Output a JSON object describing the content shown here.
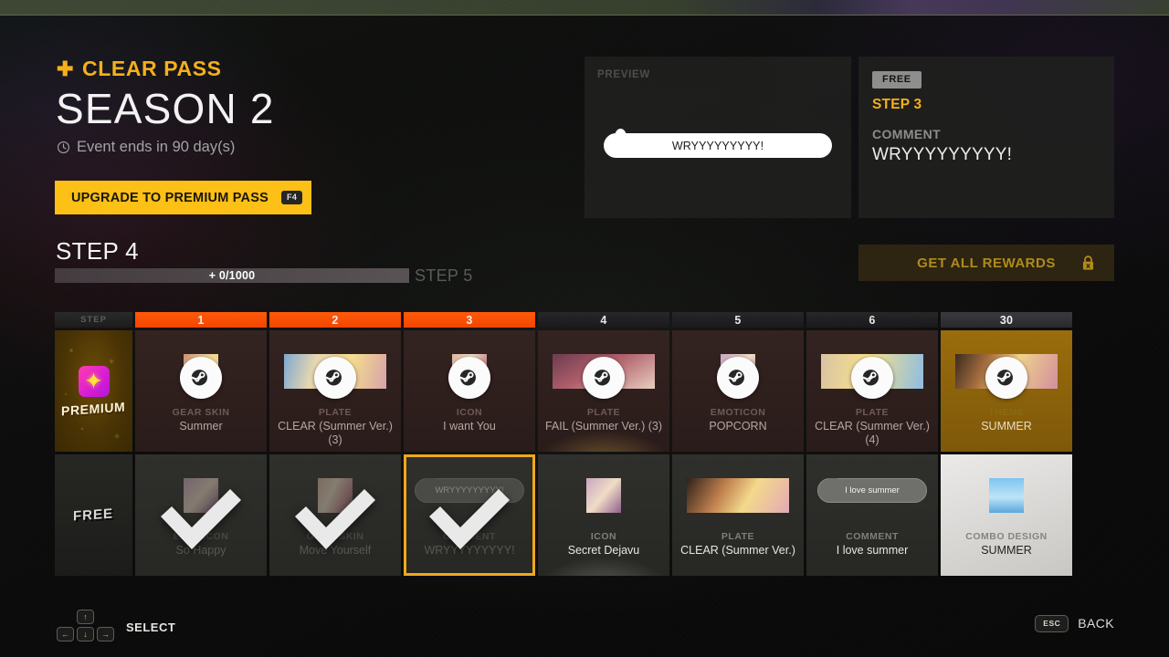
{
  "header": {
    "clear_pass_label": "CLEAR PASS",
    "clear_pass_star_icon": "plus-star-icon",
    "season_title": "SEASON 2",
    "event_text": "Event ends in 90 day(s)",
    "clock_icon": "clock-icon",
    "upgrade_button_label": "UPGRADE TO PREMIUM PASS",
    "upgrade_button_key": "F4"
  },
  "preview": {
    "label": "PREVIEW",
    "bubble_text": "WRYYYYYYYYY!"
  },
  "info": {
    "badge": "FREE",
    "step": "STEP 3",
    "category": "COMMENT",
    "name": "WRYYYYYYYYY!"
  },
  "progress": {
    "current_step_label": "STEP 4",
    "bar_text": "+ 0/1000",
    "percent": 0,
    "next_step_label": "STEP 5"
  },
  "rewards_button": {
    "label": "GET ALL REWARDS",
    "lock_icon": "lock-icon",
    "locked": true
  },
  "grid": {
    "step_header_label": "STEP",
    "steps": [
      {
        "label": "1",
        "state": "done"
      },
      {
        "label": "2",
        "state": "done"
      },
      {
        "label": "3",
        "state": "done"
      },
      {
        "label": "4",
        "state": "todo"
      },
      {
        "label": "5",
        "state": "todo"
      },
      {
        "label": "6",
        "state": "todo"
      },
      {
        "label": "30",
        "state": "far"
      }
    ],
    "premium_label": "PREMIUM",
    "free_label": "FREE",
    "premium_row": [
      {
        "category": "GEAR SKIN",
        "name": "Summer",
        "locked": true,
        "thumb": "sq",
        "art": "t1",
        "highlight": false
      },
      {
        "category": "PLATE",
        "name": "CLEAR (Summer Ver.) (3)",
        "locked": true,
        "thumb": "wide",
        "art": "t2",
        "highlight": false
      },
      {
        "category": "ICON",
        "name": "I want You",
        "locked": true,
        "thumb": "sq",
        "art": "t3",
        "highlight": false
      },
      {
        "category": "PLATE",
        "name": "FAIL (Summer Ver.) (3)",
        "locked": true,
        "thumb": "wide",
        "art": "t4",
        "highlight": true
      },
      {
        "category": "EMOTICON",
        "name": "POPCORN",
        "locked": true,
        "thumb": "sq",
        "art": "t7",
        "highlight": false
      },
      {
        "category": "PLATE",
        "name": "CLEAR (Summer Ver.) (4)",
        "locked": true,
        "thumb": "wide",
        "art": "t5",
        "highlight": false
      },
      {
        "category": "THEME",
        "name": "SUMMER",
        "locked": true,
        "thumb": "wide",
        "art": "tbanner",
        "gold": true,
        "highlight": false
      }
    ],
    "free_row": [
      {
        "category": "EMOTICON",
        "name": "So Happy",
        "claimed": true,
        "thumb": "sq",
        "art": "t7"
      },
      {
        "category": "GEAR SKIN",
        "name": "Move Yourself",
        "claimed": true,
        "thumb": "sq",
        "art": "t3"
      },
      {
        "category": "COMMENT",
        "name": "WRYYYYYYYYY!",
        "claimed": true,
        "thumb": "bub",
        "bubble": "WRYYYYYYYYY!",
        "selected": true
      },
      {
        "category": "ICON",
        "name": "Secret Dejavu",
        "claimed": false,
        "thumb": "sq",
        "art": "t7",
        "glow": true
      },
      {
        "category": "PLATE",
        "name": "CLEAR (Summer Ver.)",
        "claimed": false,
        "thumb": "wide",
        "art": "t8"
      },
      {
        "category": "COMMENT",
        "name": "I love summer",
        "claimed": false,
        "thumb": "bub",
        "bubble": "I love summer"
      },
      {
        "category": "COMBO DESIGN",
        "name": "SUMMER",
        "claimed": false,
        "thumb": "sq",
        "art": "t9",
        "light": true
      }
    ]
  },
  "footer": {
    "select_label": "SELECT",
    "arrow_up": "↑",
    "arrow_left": "←",
    "arrow_down": "↓",
    "arrow_right": "→",
    "esc_key": "ESC",
    "back_label": "BACK"
  },
  "colors": {
    "accent_gold": "#f5b01a",
    "button_yellow": "#fcc016",
    "step_done_orange": "#ff5a0a",
    "selected_border": "#f0a81c"
  }
}
